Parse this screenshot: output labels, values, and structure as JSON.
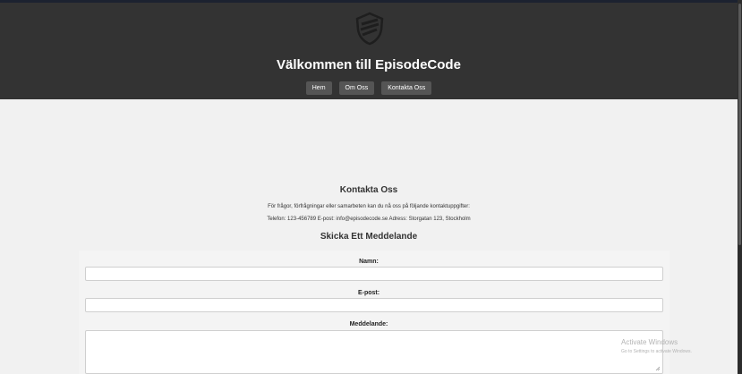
{
  "header": {
    "site_title": "Välkommen till EpisodeCode",
    "logo_icon": "shield-logo-icon"
  },
  "nav": {
    "items": [
      {
        "label": "Hem"
      },
      {
        "label": "Om Oss"
      },
      {
        "label": "Kontakta Oss"
      }
    ]
  },
  "contact": {
    "heading": "Kontakta Oss",
    "intro": "För frågor, förfrågningar eller samarbeten kan du nå oss på följande kontaktuppgifter:",
    "details": "Telefon: 123-456789 E-post: info@episodecode.se Adress: Storgatan 123, Stockholm"
  },
  "form": {
    "heading": "Skicka Ett Meddelande",
    "name_label": "Namn:",
    "email_label": "E-post:",
    "message_label": "Meddelande:",
    "name_value": "",
    "email_value": "",
    "message_value": ""
  },
  "watermark": {
    "title": "Activate Windows",
    "subtitle": "Go to Settings to activate Windows."
  },
  "colors": {
    "header_bg": "#333333",
    "nav_button_bg": "#555555",
    "page_bg": "#f1f1f1"
  }
}
